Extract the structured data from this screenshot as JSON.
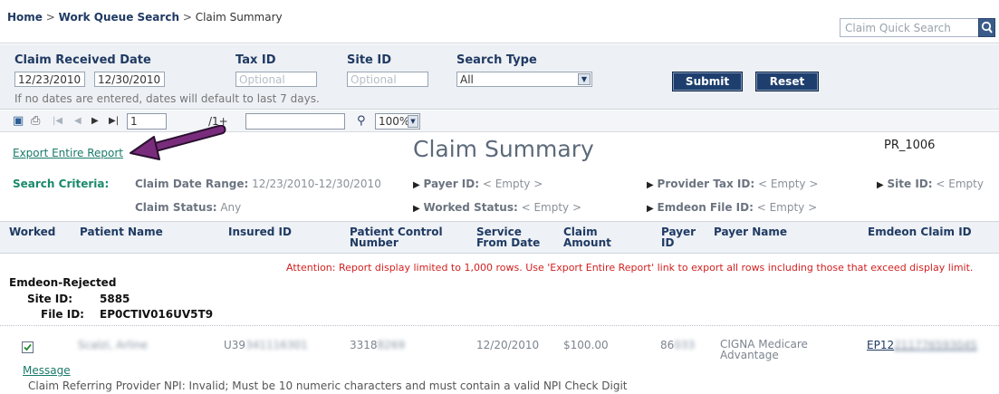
{
  "breadcrumb": {
    "home": "Home",
    "sep": ">",
    "work_queue": "Work Queue Search",
    "current": "Claim Summary"
  },
  "quick_search": {
    "placeholder": "Claim Quick Search"
  },
  "filters": {
    "received_date_label": "Claim Received Date",
    "date_from": "12/23/2010",
    "date_to": "12/30/2010",
    "tax_id_label": "Tax ID",
    "tax_id_placeholder": "Optional",
    "site_id_label": "Site ID",
    "site_id_placeholder": "Optional",
    "search_type_label": "Search Type",
    "search_type_value": "All",
    "submit": "Submit",
    "reset": "Reset",
    "hint": "If no dates are entered, dates will default to last 7 days."
  },
  "toolbar": {
    "page": "1",
    "page_of": "/1+",
    "zoom": "100%"
  },
  "report": {
    "export_link": "Export Entire Report",
    "title": "Claim Summary",
    "report_id": "PR_1006"
  },
  "criteria": {
    "label": "Search Criteria:",
    "date_range_key": "Claim Date Range:",
    "date_range_val": "12/23/2010-12/30/2010",
    "payer_id_key": "Payer ID:",
    "payer_id_val": "< Empty >",
    "provider_tax_key": "Provider Tax ID:",
    "provider_tax_val": "< Empty >",
    "site_id_key": "Site ID:",
    "site_id_val": "< Empty",
    "claim_status_key": "Claim Status:",
    "claim_status_val": "Any",
    "worked_status_key": "Worked Status:",
    "worked_status_val": "< Empty >",
    "file_id_key": "Emdeon File ID:",
    "file_id_val": "< Empty >"
  },
  "columns": {
    "worked": "Worked",
    "patient_name": "Patient Name",
    "insured_id": "Insured ID",
    "pcn_1": "Patient Control",
    "pcn_2": "Number",
    "service_1": "Service",
    "service_2": "From Date",
    "amount_1": "Claim",
    "amount_2": "Amount",
    "payer_id_1": "Payer",
    "payer_id_2": "ID",
    "payer_name": "Payer Name",
    "claim_id": "Emdeon Claim ID"
  },
  "attention": "Attention:  Report display limited to 1,000 rows. Use 'Export Entire Report' link to export all rows including those that exceed display limit.",
  "group": {
    "status": "Emdeon-Rejected",
    "site_label": "Site ID:",
    "site_value": "5885",
    "file_label": "File ID:",
    "file_value": "EP0CTIV016UV5T9"
  },
  "row": {
    "worked": true,
    "patient_name": "Scalzi, Arline",
    "insured_id_prefix": "U39",
    "insured_id_hidden": "341116301",
    "pcn_prefix": "3318",
    "pcn_hidden": "8269",
    "service_date": "12/20/2010",
    "amount": "$100.00",
    "payer_id_prefix": "86",
    "payer_id_hidden": "033",
    "payer_name_1": "CIGNA Medicare",
    "payer_name_2": "Advantage",
    "claim_id_prefix": "EP12",
    "claim_id_hidden": "21177659304S",
    "message_link": "Message",
    "error": "Claim Referring Provider NPI: Invalid; Must be 10 numeric characters and must contain a valid NPI Check Digit"
  }
}
